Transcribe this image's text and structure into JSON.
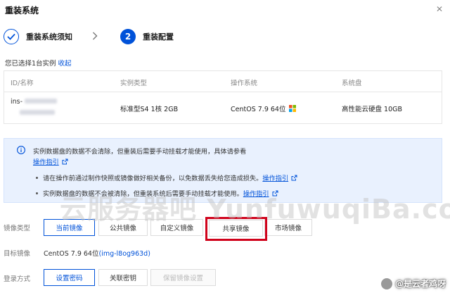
{
  "dialog": {
    "title": "重装系统"
  },
  "steps": [
    {
      "label": "重装系统须知",
      "state": "done"
    },
    {
      "number": "2",
      "label": "重装配置",
      "state": "current"
    }
  ],
  "selected": {
    "text": "您已选择1台实例",
    "collapse": "收起"
  },
  "table": {
    "headers": [
      "ID/名称",
      "实例类型",
      "操作系统",
      "系统盘"
    ],
    "row": {
      "id_prefix": "ins-",
      "type": "标准型S4 1核 2GB",
      "os": "CentOS 7.9 64位",
      "disk": "高性能云硬盘 10GB"
    }
  },
  "notice": {
    "main": "实例数据盘的数据不会清除，但重装后需要手动挂载才能使用，具体请参看",
    "main_link": "操作指引",
    "bullets": [
      {
        "text": "请在操作前通过制作快照或镜像做好相关备份，以免数据丢失给您造成损失。",
        "link": "操作指引"
      },
      {
        "text": "实例数据盘的数据不会被清除，但重装系统后需要手动挂载才能使用。",
        "link": "操作指引"
      }
    ]
  },
  "watermark": "云服务器吧 YunfuwuqiBa.com",
  "image_type": {
    "label": "镜像类型",
    "options": [
      "当前镜像",
      "公共镜像",
      "自定义镜像",
      "共享镜像",
      "市场镜像"
    ],
    "selected": "当前镜像"
  },
  "target_image": {
    "label": "目标镜像",
    "value": "CentOS 7.9 64位",
    "id": "(img-l8og963d)"
  },
  "login": {
    "label": "登录方式",
    "options": [
      "设置密码",
      "关联密钥",
      "保留镜像设置"
    ],
    "selected": "设置密码"
  },
  "corner_watermark": "@是云者鸡呀",
  "colors": {
    "primary": "#0052d9",
    "notice_bg": "#e9f1fe",
    "highlight": "#d0021b"
  }
}
